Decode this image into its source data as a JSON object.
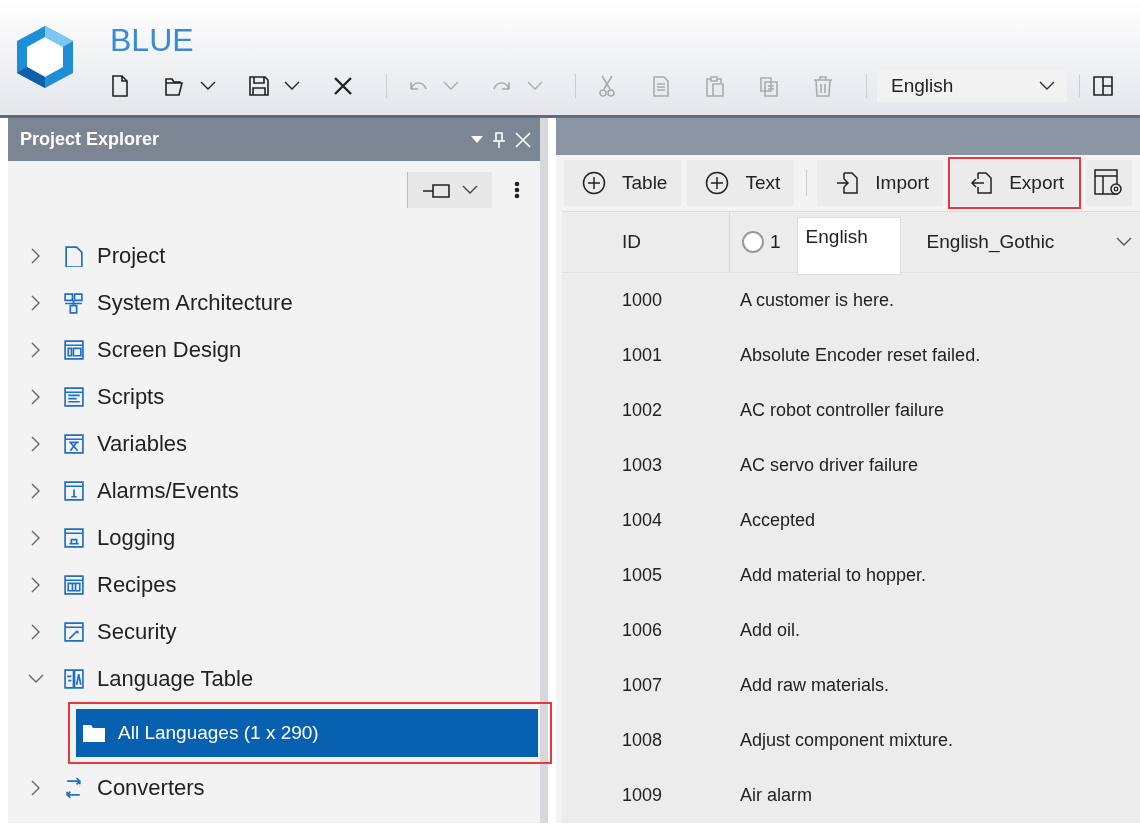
{
  "app": {
    "title": "BLUE"
  },
  "toolbar": [
    {
      "disabled": false,
      "dropdown": false
    },
    {
      "disabled": false,
      "dropdown": true
    },
    {
      "disabled": false,
      "dropdown": true
    },
    {
      "disabled": false,
      "dropdown": false
    },
    {
      "disabled": true,
      "dropdown": true
    },
    {
      "disabled": true,
      "dropdown": true
    },
    {
      "disabled": true,
      "dropdown": false
    },
    {
      "disabled": true,
      "dropdown": false
    },
    {
      "disabled": true,
      "dropdown": false
    },
    {
      "disabled": true,
      "dropdown": false
    },
    {
      "disabled": true,
      "dropdown": false
    }
  ],
  "language_select": {
    "value": "English"
  },
  "explorer": {
    "title": "Project Explorer",
    "tree": [
      {
        "label": "Project",
        "expanded": false
      },
      {
        "label": "System Architecture",
        "expanded": false
      },
      {
        "label": "Screen Design",
        "expanded": false
      },
      {
        "label": "Scripts",
        "expanded": false
      },
      {
        "label": "Variables",
        "expanded": false
      },
      {
        "label": "Alarms/Events",
        "expanded": false
      },
      {
        "label": "Logging",
        "expanded": false
      },
      {
        "label": "Recipes",
        "expanded": false
      },
      {
        "label": "Security",
        "expanded": false
      },
      {
        "label": "Language Table",
        "expanded": true,
        "children": [
          {
            "label": "All Languages (1 x 290)",
            "selected": true,
            "highlighted": true
          }
        ]
      },
      {
        "label": "Converters",
        "expanded": false
      }
    ]
  },
  "table_toolbar": [
    {
      "kind": "add",
      "label": "Table",
      "highlighted": false
    },
    {
      "kind": "add",
      "label": "Text",
      "highlighted": false
    },
    {
      "kind": "import",
      "label": "Import",
      "highlighted": false
    },
    {
      "kind": "export",
      "label": "Export",
      "highlighted": true
    }
  ],
  "table": {
    "id_header": "ID",
    "language_index": "1",
    "language_checked": false,
    "language_name": "English",
    "font": "English_Gothic",
    "rows": [
      {
        "id": "1000",
        "text": "A customer is here."
      },
      {
        "id": "1001",
        "text": "Absolute Encoder reset failed."
      },
      {
        "id": "1002",
        "text": "AC robot controller failure"
      },
      {
        "id": "1003",
        "text": "AC servo driver failure"
      },
      {
        "id": "1004",
        "text": "Accepted"
      },
      {
        "id": "1005",
        "text": "Add material to hopper."
      },
      {
        "id": "1006",
        "text": "Add oil."
      },
      {
        "id": "1007",
        "text": "Add raw materials."
      },
      {
        "id": "1008",
        "text": "Adjust component mixture."
      },
      {
        "id": "1009",
        "text": "Air alarm"
      }
    ]
  }
}
